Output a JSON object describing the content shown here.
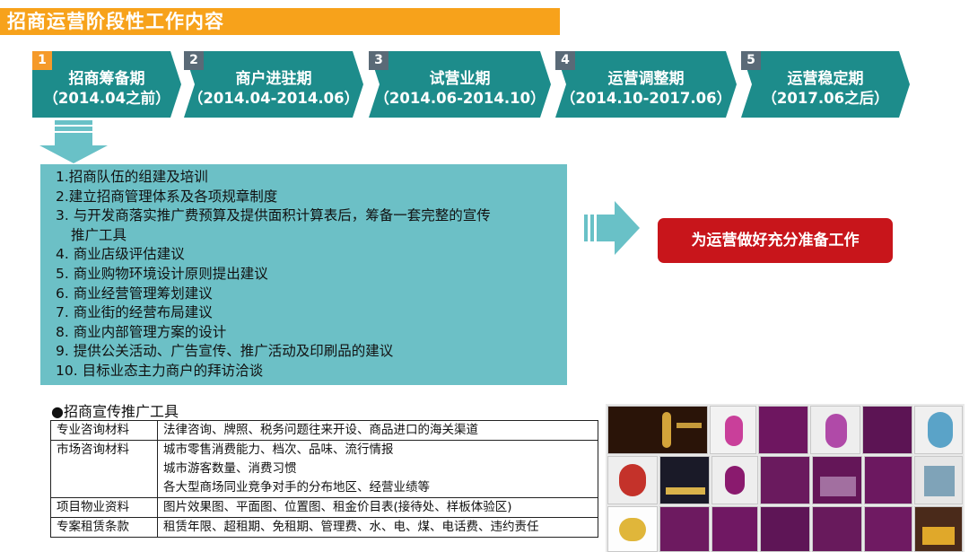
{
  "title": "招商运营阶段性工作内容",
  "phases": [
    {
      "num": "1",
      "name": "招商筹备期",
      "date": "（2014.04之前）"
    },
    {
      "num": "2",
      "name": "商户进驻期",
      "date": "（2014.04-2014.06）"
    },
    {
      "num": "3",
      "name": "试营业期",
      "date": "（2014.06-2014.10）"
    },
    {
      "num": "4",
      "name": "运营调整期",
      "date": "（2014.10-2017.06）"
    },
    {
      "num": "5",
      "name": "运营稳定期",
      "date": "（2017.06之后）"
    }
  ],
  "tasks": [
    "1.招商队伍的组建及培训",
    "2.建立招商管理体系及各项规章制度",
    "3. 与开发商落实推广费预算及提供面积计算表后，筹备一套完整的宣传",
    "推广工具",
    "4. 商业店级评估建议",
    "5. 商业购物环境设计原则提出建议",
    "6. 商业经营管理筹划建议",
    "7. 商业街的经营布局建议",
    "8. 商业内部管理方案的设计",
    "9. 提供公关活动、广告宣传、推广活动及印刷品的建议",
    "10. 目标业态主力商户的拜访洽谈"
  ],
  "goal": "为运营做好充分准备工作",
  "tools_title": "●招商宣传推广工具",
  "tools_table": [
    {
      "label": "专业咨询材料",
      "lines": [
        "法律咨询、牌照、税务问题往来开设、商品进口的海关渠道"
      ]
    },
    {
      "label": "市场咨询材料",
      "lines": [
        "城市零售消费能力、档次、品味、流行情报",
        "城市游客数量、消费习惯",
        "各大型商场同业竞争对手的分布地区、经营业绩等"
      ]
    },
    {
      "label": "项目物业资料",
      "lines": [
        "图片效果图、平面图、位置图、租金价目表(接待处、样板体验区)"
      ]
    },
    {
      "label": "专案租赁条款",
      "lines": [
        "租赁年限、超租期、免租期、管理费、水、电、煤、电话费、违约责任"
      ]
    }
  ],
  "colors": {
    "title_bg": "#f7a21b",
    "phase_bg": "#1d8c8b",
    "task_bg": "#6cc0c6",
    "goal_bg": "#c8151b",
    "arrow": "#69c1c7"
  }
}
